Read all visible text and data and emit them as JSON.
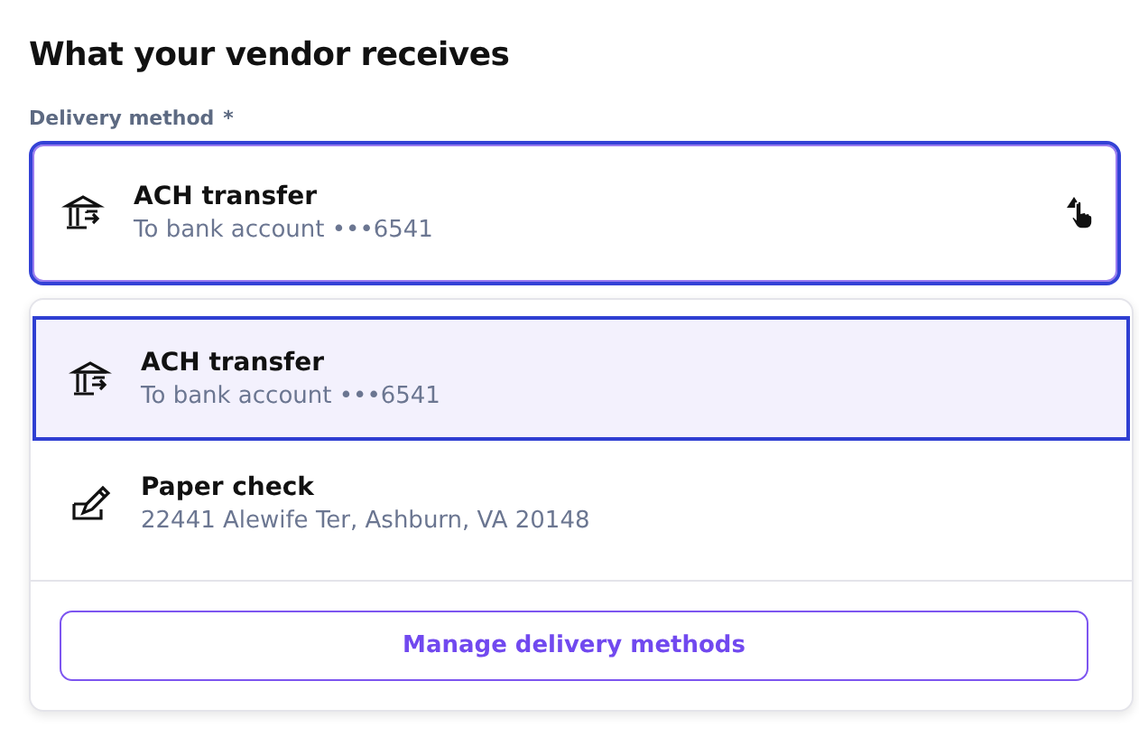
{
  "heading": "What your vendor receives",
  "field": {
    "label": "Delivery method",
    "required_mark": "*",
    "expanded": true,
    "value": {
      "kind": "bank",
      "title": "ACH transfer",
      "detail": "To bank account •••6541"
    }
  },
  "options": [
    {
      "kind": "bank",
      "title": "ACH transfer",
      "detail": "To bank account •••6541",
      "selected": true
    },
    {
      "kind": "check",
      "title": "Paper check",
      "detail": "22441 Alewife Ter, Ashburn, VA 20148",
      "selected": false
    }
  ],
  "footer_button": "Manage delivery methods"
}
